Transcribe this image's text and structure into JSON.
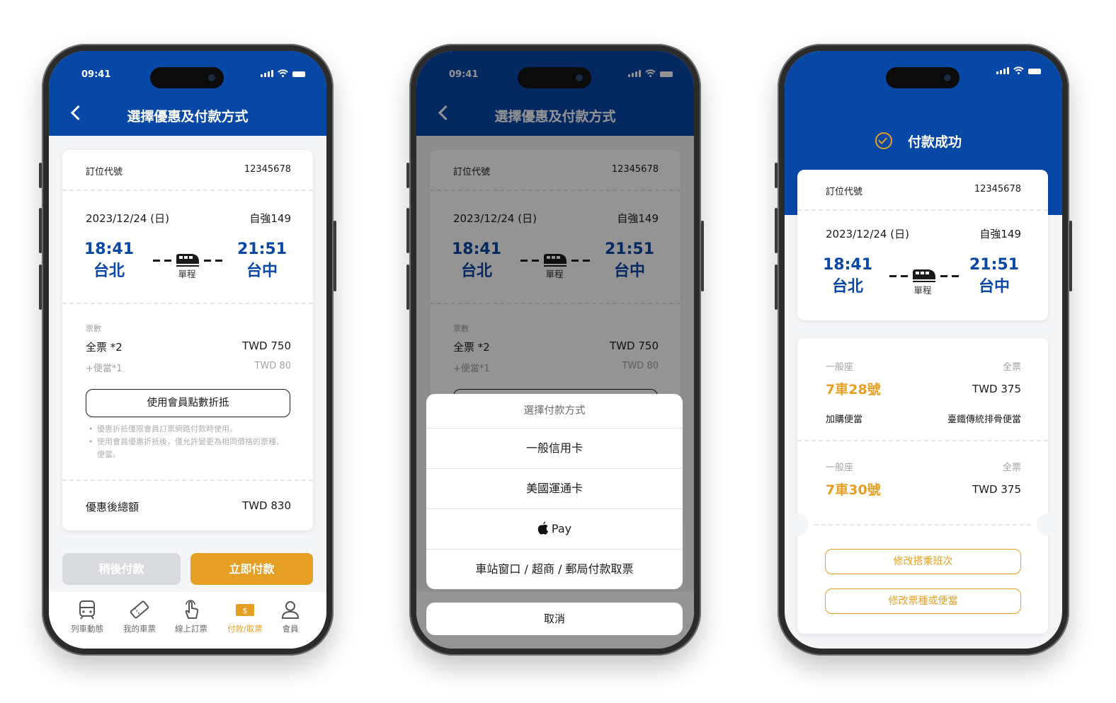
{
  "status": {
    "time": "09:41"
  },
  "booking": {
    "code_label": "訂位代號",
    "code": "12345678",
    "date": "2023/12/24 (日)",
    "train": "自強149",
    "dep_time": "18:41",
    "dep_station": "台北",
    "arr_time": "21:51",
    "arr_station": "台中",
    "trip_type": "單程"
  },
  "screen1": {
    "title": "選擇優惠及付款方式",
    "tickets_label": "票數",
    "full_ticket": "全票 *2",
    "full_price": "TWD 750",
    "bento": "+便當*1",
    "bento_price": "TWD 80",
    "points_button": "使用會員點數折抵",
    "note1": "優惠折抵僅限會員訂票網路付款時使用。",
    "note2": "使用會員優惠折抵後，僅允許變更為相同價格的票種、便當。",
    "total_label": "優惠後總額",
    "total": "TWD 830",
    "later_button": "稍後付款",
    "pay_button": "立即付款"
  },
  "tabs": [
    {
      "label": "列車動態",
      "icon": "train-icon"
    },
    {
      "label": "我的車票",
      "icon": "ticket-icon"
    },
    {
      "label": "線上訂票",
      "icon": "tap-hand-icon"
    },
    {
      "label": "付款/取票",
      "icon": "payment-icon"
    },
    {
      "label": "會員",
      "icon": "user-icon"
    }
  ],
  "screen2": {
    "sheet_title": "選擇付款方式",
    "options": [
      "一般信用卡",
      "美國運通卡",
      "Pay",
      "車站窗口 / 超商 / 郵局付款取票"
    ],
    "cancel": "取消"
  },
  "screen3": {
    "title": "付款成功",
    "seats": [
      {
        "class": "一般座",
        "type": "全票",
        "seat": "7車28號",
        "price": "TWD 375",
        "addon_label": "加購便當",
        "addon": "臺鐵傳統排骨便當"
      },
      {
        "class": "一般座",
        "type": "全票",
        "seat": "7車30號",
        "price": "TWD 375"
      }
    ],
    "change_train": "修改搭乘班次",
    "change_ticket": "修改票種或便當"
  },
  "colors": {
    "primary": "#0747a6",
    "accent": "#e5a024"
  }
}
